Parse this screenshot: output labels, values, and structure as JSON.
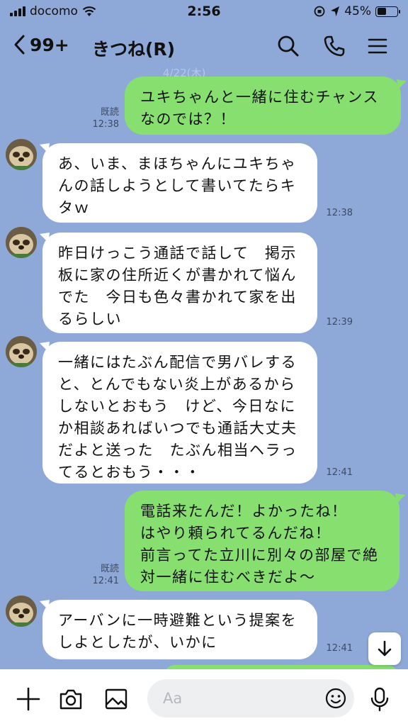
{
  "status_bar": {
    "carrier": "docomo",
    "time": "2:56",
    "battery": "45%"
  },
  "header": {
    "back_count": "99+",
    "title": "きつね(R)",
    "ghost_date": "4/22(木)"
  },
  "messages": [
    {
      "side": "out",
      "text": "ユキちゃんと一緒に住むチャンス\nなのでは？！",
      "read": "既読",
      "time": "12:38"
    },
    {
      "side": "in",
      "text": "あ、いま、まほちゃんにユキちゃ\nんの話しようとして書いてたらキ\nタｗ",
      "time": "12:38"
    },
    {
      "side": "in",
      "text": "昨日けっこう通話で話して　掲示\n板に家の住所近くが書かれて悩ん\nでた　今日も色々書かれて家を出\nるらしい",
      "time": "12:39"
    },
    {
      "side": "in",
      "text": "一緒にはたぶん配信で男バレする\nと、とんでもない炎上があるから\nしないとおもう　けど、今日なに\nか相談あればいつでも通話大丈夫\nだよと送った　たぶん相当ヘラっ\nてるとおもう・・・",
      "time": "12:41"
    },
    {
      "side": "out",
      "text": "電話来たんだ！よかったね！\nはやり頼られてるんだね！\n前言ってた立川に別々の部屋で絶\n対一緒に住むべきだよ〜",
      "read": "既読",
      "time": "12:41"
    },
    {
      "side": "in",
      "text": "アーバンに一時避難という提案を\nしよとしたが、いかに",
      "time": "12:41"
    }
  ],
  "input": {
    "placeholder": "Aa"
  },
  "colors": {
    "background": "#8ea9d8",
    "outgoing_bubble": "#86df6f",
    "incoming_bubble": "#ffffff"
  },
  "icons": [
    "chevron-left-icon",
    "search-icon",
    "phone-icon",
    "menu-icon",
    "plus-icon",
    "camera-icon",
    "image-icon",
    "emoji-icon",
    "mic-icon",
    "arrow-down-icon"
  ]
}
